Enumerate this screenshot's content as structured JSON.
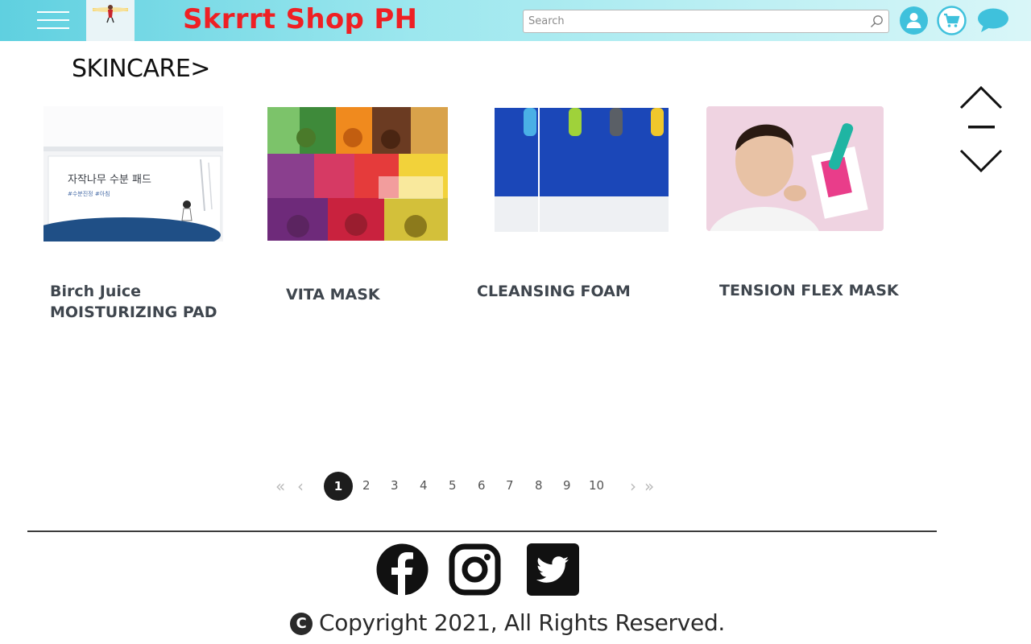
{
  "header": {
    "shop_title": "Skrrrt Shop PH",
    "search_placeholder": "Search",
    "title_color": "#ee2024",
    "icons": [
      "menu-icon",
      "logo",
      "search-icon",
      "user-icon",
      "cart-icon",
      "chat-icon"
    ]
  },
  "category": {
    "label": "SKINCARE>"
  },
  "products": [
    {
      "name_line1": "Birch Juice",
      "name_line2": "MOISTURIZING PAD",
      "image_text": "자작나무 수분 패드"
    },
    {
      "name_line1": "VITA MASK"
    },
    {
      "name_line1": "CLEANSING FOAM"
    },
    {
      "name_line1": "TENSION FLEX MASK"
    }
  ],
  "pagination": {
    "first": "«",
    "prev": "‹",
    "current": "1",
    "pages": [
      "2",
      "3",
      "4",
      "5",
      "6",
      "7",
      "8",
      "9",
      "10"
    ],
    "next": "›",
    "last": "»"
  },
  "footer": {
    "social": [
      "facebook-icon",
      "instagram-icon",
      "twitter-icon"
    ],
    "copyright_symbol": "C",
    "copyright_text": "Copyright 2021, All Rights Reserved."
  }
}
